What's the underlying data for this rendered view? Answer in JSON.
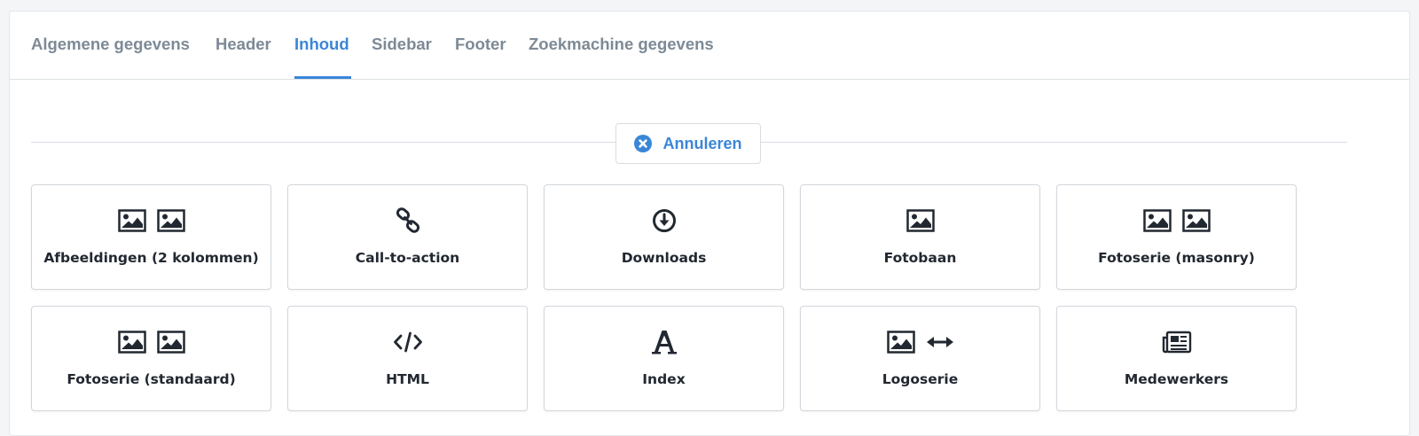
{
  "tabs": [
    {
      "label": "Algemene gegevens",
      "active": false
    },
    {
      "label": "Header",
      "active": false
    },
    {
      "label": "Inhoud",
      "active": true
    },
    {
      "label": "Sidebar",
      "active": false
    },
    {
      "label": "Footer",
      "active": false
    },
    {
      "label": "Zoekmachine gegevens",
      "active": false
    }
  ],
  "cancel_button": {
    "label": "Annuleren",
    "icon": "times-circle-icon"
  },
  "content_blocks": [
    {
      "label": "Afbeeldingen (2 kolommen)",
      "icons": [
        "image-icon",
        "image-icon"
      ]
    },
    {
      "label": "Call-to-action",
      "icons": [
        "link-icon"
      ]
    },
    {
      "label": "Downloads",
      "icons": [
        "download-circle-icon"
      ]
    },
    {
      "label": "Fotobaan",
      "icons": [
        "image-icon"
      ]
    },
    {
      "label": "Fotoserie (masonry)",
      "icons": [
        "image-icon",
        "image-icon"
      ]
    },
    {
      "label": "Fotoserie (standaard)",
      "icons": [
        "image-icon",
        "image-icon"
      ]
    },
    {
      "label": "HTML",
      "icons": [
        "code-icon"
      ]
    },
    {
      "label": "Index",
      "icons": [
        "font-a-icon"
      ]
    },
    {
      "label": "Logoserie",
      "icons": [
        "image-icon",
        "arrows-horizontal-icon"
      ]
    },
    {
      "label": "Medewerkers",
      "icons": [
        "newspaper-icon"
      ]
    }
  ],
  "colors": {
    "accent": "#3a86d8",
    "tab_inactive": "#7d8a96",
    "text": "#222831",
    "border": "#d3d7dc"
  }
}
